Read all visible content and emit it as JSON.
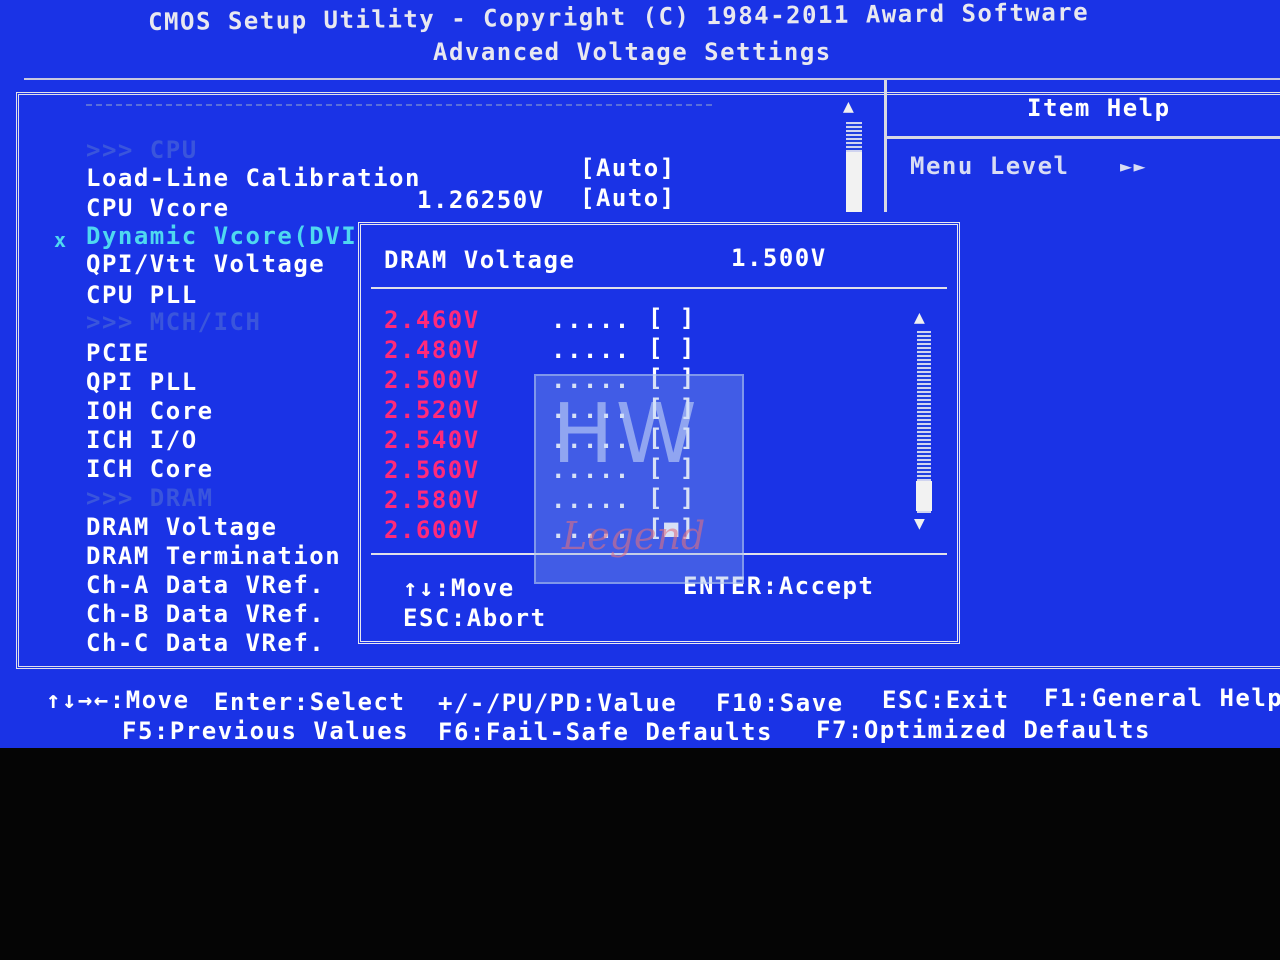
{
  "header": {
    "title_line1": "CMOS Setup Utility - Copyright (C) 1984-2011 Award Software",
    "title_line2": "Advanced Voltage Settings"
  },
  "menu": {
    "sep_cpu": ">>> CPU",
    "items": [
      {
        "label": "Load-Line Calibration",
        "value": "",
        "bracket": "[Auto]"
      },
      {
        "label": "CPU Vcore",
        "value": "1.26250V",
        "bracket": "[Auto]"
      },
      {
        "label": "Dynamic Vcore(DVI",
        "prefix": "x"
      },
      {
        "label": "QPI/Vtt Voltage"
      },
      {
        "label": "CPU PLL"
      },
      {
        "label": "PCIE"
      },
      {
        "label": "QPI PLL"
      },
      {
        "label": "IOH Core"
      },
      {
        "label": "ICH I/O"
      },
      {
        "label": "ICH Core"
      },
      {
        "label": "DRAM Voltage"
      },
      {
        "label": "DRAM Termination"
      },
      {
        "label": "Ch-A Data VRef."
      },
      {
        "label": "Ch-B Data VRef."
      },
      {
        "label": "Ch-C Data VRef."
      }
    ],
    "sep_mch": ">>> MCH/ICH",
    "sep_dram": ">>> DRAM"
  },
  "help": {
    "title": "Item Help",
    "menu_level": "Menu Level",
    "menu_level_arrows": "►►"
  },
  "popup": {
    "title": "DRAM Voltage",
    "current": "1.500V",
    "options": [
      {
        "value": "2.460V",
        "dots": ".....",
        "mark": "[ ]"
      },
      {
        "value": "2.480V",
        "dots": ".....",
        "mark": "[ ]"
      },
      {
        "value": "2.500V",
        "dots": ".....",
        "mark": "[ ]"
      },
      {
        "value": "2.520V",
        "dots": ".....",
        "mark": "[ ]"
      },
      {
        "value": "2.540V",
        "dots": ".....",
        "mark": "[ ]"
      },
      {
        "value": "2.560V",
        "dots": ".....",
        "mark": "[ ]"
      },
      {
        "value": "2.580V",
        "dots": ".....",
        "mark": "[ ]"
      },
      {
        "value": "2.600V",
        "dots": ".....",
        "mark": "[■]"
      }
    ],
    "hint_move": "↑↓:Move",
    "hint_accept": "ENTER:Accept",
    "hint_abort": "ESC:Abort"
  },
  "footer": {
    "line1": [
      {
        "text": "↑↓→←:Move"
      },
      {
        "text": "Enter:Select"
      },
      {
        "text": "+/-/PU/PD:Value"
      },
      {
        "text": "F10:Save"
      },
      {
        "text": "ESC:Exit"
      },
      {
        "text": "F1:General Help"
      }
    ],
    "line2": [
      {
        "text": "F5:Previous Values"
      },
      {
        "text": "F6:Fail-Safe Defaults"
      },
      {
        "text": "F7:Optimized Defaults"
      }
    ]
  },
  "watermark": {
    "letters": "HW",
    "script": "Legend"
  },
  "colors": {
    "background": "#1a33e6",
    "highlight_value": "#ff2a7a",
    "selected_item": "#4fd8f0",
    "disabled": "#3a55dc"
  }
}
